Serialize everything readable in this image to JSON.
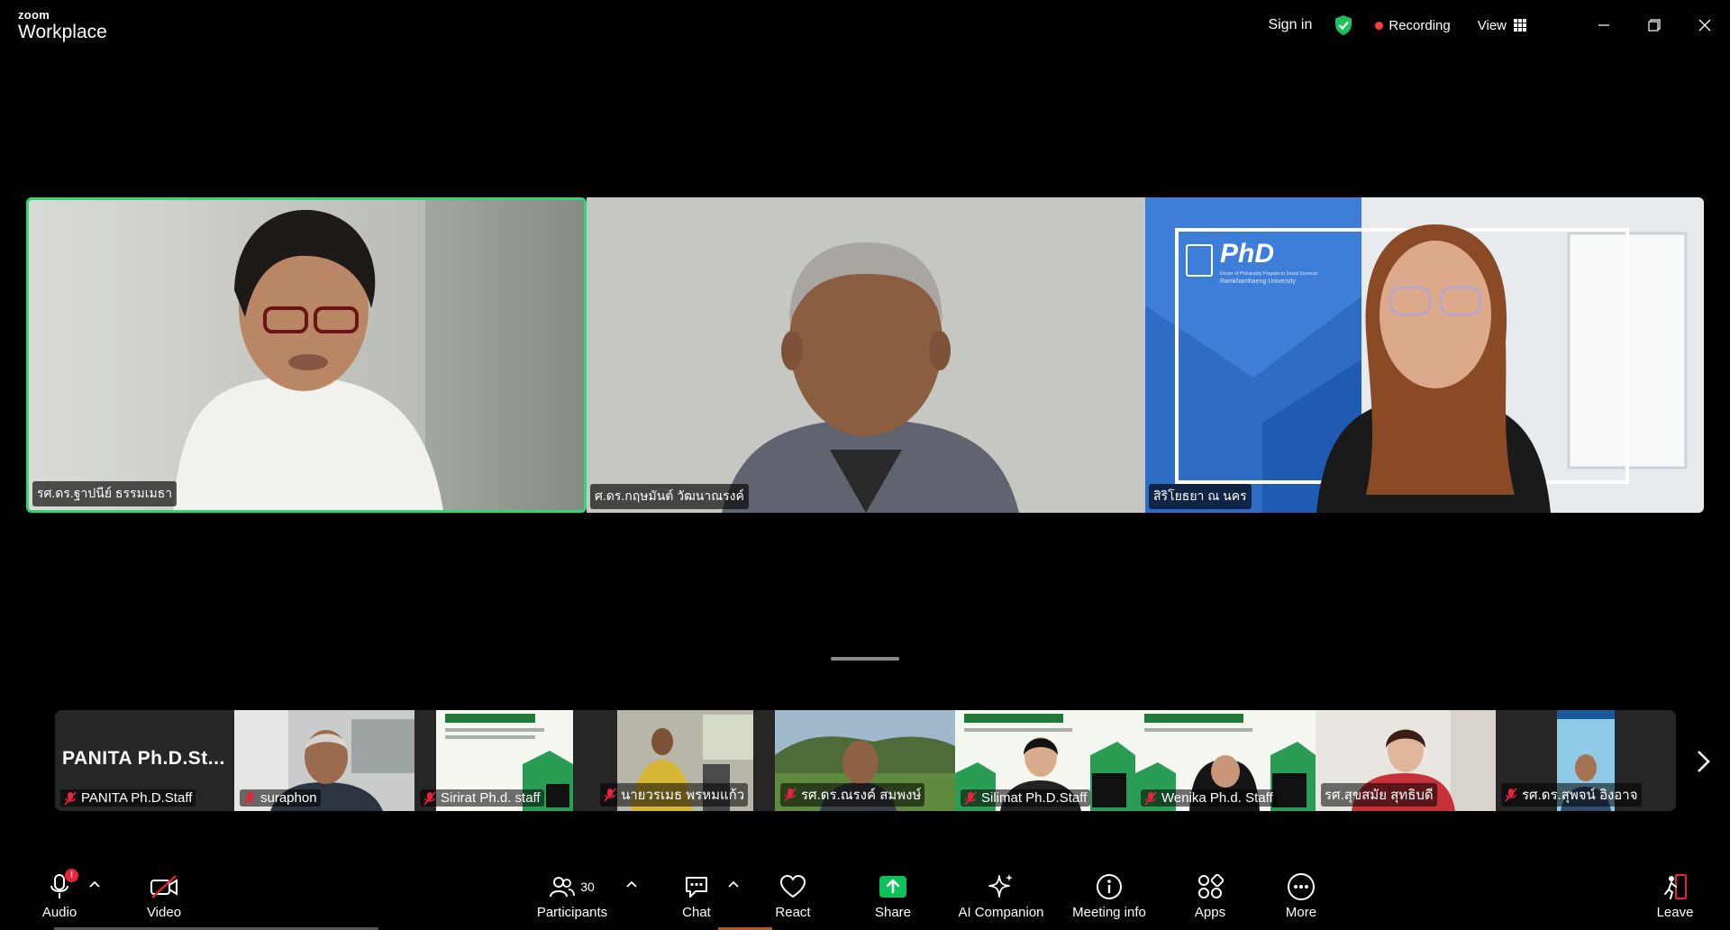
{
  "app": {
    "brand_top": "zoom",
    "brand_bottom": "Workplace"
  },
  "titlebar": {
    "sign_in": "Sign in",
    "recording": "Recording",
    "view": "View"
  },
  "main_tiles": [
    {
      "name": "รศ.ดร.ฐาปนีย์ ธรรมเมธา",
      "active_speaker": true
    },
    {
      "name": "ศ.ดร.กฤษมันต์ วัฒนาณรงค์",
      "active_speaker": false
    },
    {
      "name": "สิริโยธยา ณ นคร",
      "active_speaker": false
    }
  ],
  "phd_slide": {
    "logo_text": "PhD",
    "line1": "Doctor of Philosophy Program in Social Sciences",
    "line2": "Ramkhamhaeng University"
  },
  "thumbnails": [
    {
      "big_name": "PANITA  Ph.D.St...",
      "name": "PANITA Ph.D.Staff",
      "muted": true
    },
    {
      "name": "suraphon",
      "muted": true
    },
    {
      "name": "Sirirat Ph.d. staff",
      "muted": true
    },
    {
      "name": "นายวรเมธ พรหมแก้ว",
      "muted": true
    },
    {
      "name": "รศ.ดร.ณรงค์ สมพงษ์",
      "muted": true
    },
    {
      "name": "Silimat Ph.D.Staff",
      "muted": true
    },
    {
      "name": "Wenika Ph.d. Staff",
      "muted": true
    },
    {
      "name": "รศ.สุขสมัย สุทธิบดี",
      "muted": true
    },
    {
      "name": "รศ.ดร.สุพจน์ อิงอาจ",
      "muted": true
    }
  ],
  "toolbar": {
    "audio": "Audio",
    "audio_badge": "!",
    "video": "Video",
    "participants": "Participants",
    "participants_count": "30",
    "chat": "Chat",
    "react": "React",
    "share": "Share",
    "ai_companion": "AI Companion",
    "meeting_info": "Meeting info",
    "apps": "Apps",
    "more": "More",
    "leave": "Leave"
  },
  "colors": {
    "active_speaker_border": "#2fd877",
    "share_green": "#0bc25a",
    "recording_dot": "#ff3b3b",
    "muted_red": "#e8233a"
  }
}
